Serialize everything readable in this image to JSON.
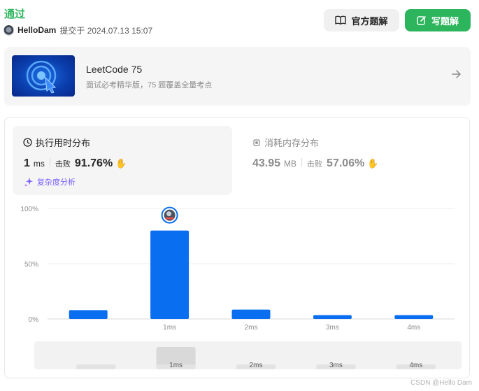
{
  "header": {
    "status": "通过",
    "username": "HelloDam",
    "submitted_text": "提交于 2024.07.13 15:07",
    "official_solution_label": "官方题解",
    "write_solution_label": "写题解"
  },
  "banner": {
    "title": "LeetCode 75",
    "subtitle": "面试必考精华版，75 题覆盖全量考点"
  },
  "runtime": {
    "heading": "执行用时分布",
    "value": "1",
    "unit": "ms",
    "beat_label": "击败",
    "beat_value": "91.76%",
    "analysis_label": "复杂度分析"
  },
  "memory": {
    "heading": "消耗内存分布",
    "value": "43.95",
    "unit": "MB",
    "beat_label": "击败",
    "beat_value": "57.06%"
  },
  "colors": {
    "accent_green": "#2db55d",
    "bar_blue": "#0a6ef0",
    "purple": "#7b61ff"
  },
  "chart_data": {
    "type": "bar",
    "categories": [
      "",
      "1ms",
      "2ms",
      "3ms",
      "4ms"
    ],
    "values": [
      8,
      80,
      8.5,
      3.5,
      3.5
    ],
    "ylim": [
      0,
      100
    ],
    "yticks": [
      "0%",
      "50%",
      "100%"
    ],
    "ytick_values": [
      0,
      50,
      100
    ],
    "marker_category": "1ms",
    "minimap_labels": [
      "",
      "1ms",
      "2ms",
      "3ms",
      "4ms"
    ],
    "grid": true
  },
  "watermark": "CSDN @Hello Dam"
}
